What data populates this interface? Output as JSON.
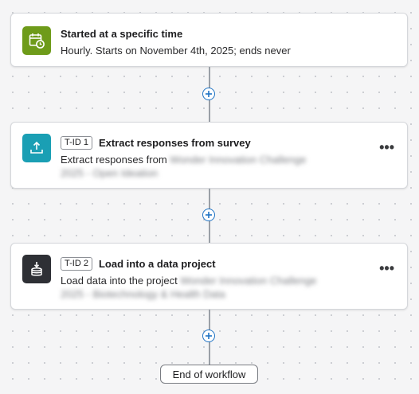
{
  "trigger": {
    "title": "Started at a specific time",
    "description": "Hourly. Starts on November 4th, 2025; ends never",
    "icon": "calendar-clock-icon",
    "icon_color": "#6e9b1a"
  },
  "tasks": [
    {
      "badge": "T-ID 1",
      "title": "Extract responses from survey",
      "description_prefix": "Extract responses from",
      "description_redacted": "Wonder Innovation Challenge 2025 - Open Ideation",
      "icon": "upload-tray-icon",
      "icon_color": "#1a9fb4"
    },
    {
      "badge": "T-ID 2",
      "title": "Load into a data project",
      "description_prefix": "Load data into the project",
      "description_redacted": "Wonder Innovation Challenge 2025 - Biotechnology & Health Data",
      "icon": "database-download-icon",
      "icon_color": "#2e3035"
    }
  ],
  "end": {
    "label": "End of workflow"
  },
  "colors": {
    "accent": "#1f73c4",
    "connector": "#9aa0a7"
  }
}
